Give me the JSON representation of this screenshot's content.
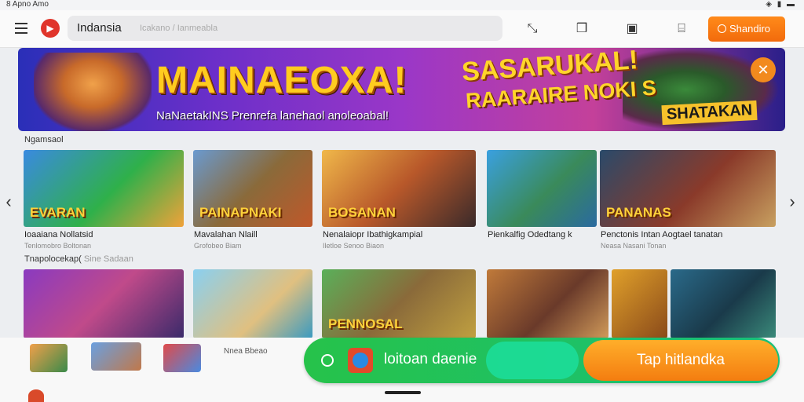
{
  "status_bar": {
    "time": "8 Apno Amo",
    "icons": "◈ ▮ ▬"
  },
  "header": {
    "search_label": "Indansia",
    "search_placeholder": "Icakano / Ianmeabla",
    "start_button_label": "Shandiro"
  },
  "banner": {
    "title": "MAINAEOXA!",
    "subtitle": "NaNaetakINS Prenrefa lanehaol anoleoabal!",
    "right_title": "SASARUKAL!",
    "right_subtitle": "RAARAIRE NOKI S",
    "badge": "SHATAKAN",
    "close_icon": "✕"
  },
  "section1": {
    "title": "Ngamsaol",
    "cards": [
      {
        "thumb_text": "EVARAN",
        "title": "Ioaaiana Nollatsid",
        "sub": "Tenlomobro Boltonan"
      },
      {
        "thumb_text": "PAINAPNAKI",
        "title": "Mavalahan Nlaill",
        "sub": "Grofobeo Biam"
      },
      {
        "thumb_text": "BOSANAN",
        "title": "Nenalaiopr Ibathigkampial",
        "sub": "Iletloe Senoo Biaon"
      },
      {
        "thumb_text": "",
        "title": "Pienkalfig Odedtang k",
        "sub": ""
      },
      {
        "thumb_text": "PANANAS",
        "title": "Penctonis Intan Aogtael tanatan",
        "sub": "Neasa Nasani Tonan"
      }
    ]
  },
  "section2": {
    "title": "Tnapolocekap(",
    "title_muted": "Sine Sadaan",
    "cards": [
      {
        "thumb_text": ""
      },
      {
        "thumb_text": ""
      },
      {
        "thumb_text": "PENNOSAL"
      },
      {
        "thumb_text": ""
      },
      {
        "thumb_text": ""
      },
      {
        "thumb_text": ""
      }
    ]
  },
  "bottom": {
    "mini_label": "Nnea Bbeao",
    "install_label": "loitoan daenie",
    "cta_label": "Tap hitlandka"
  },
  "nav": {
    "prev": "‹",
    "next": "›"
  }
}
